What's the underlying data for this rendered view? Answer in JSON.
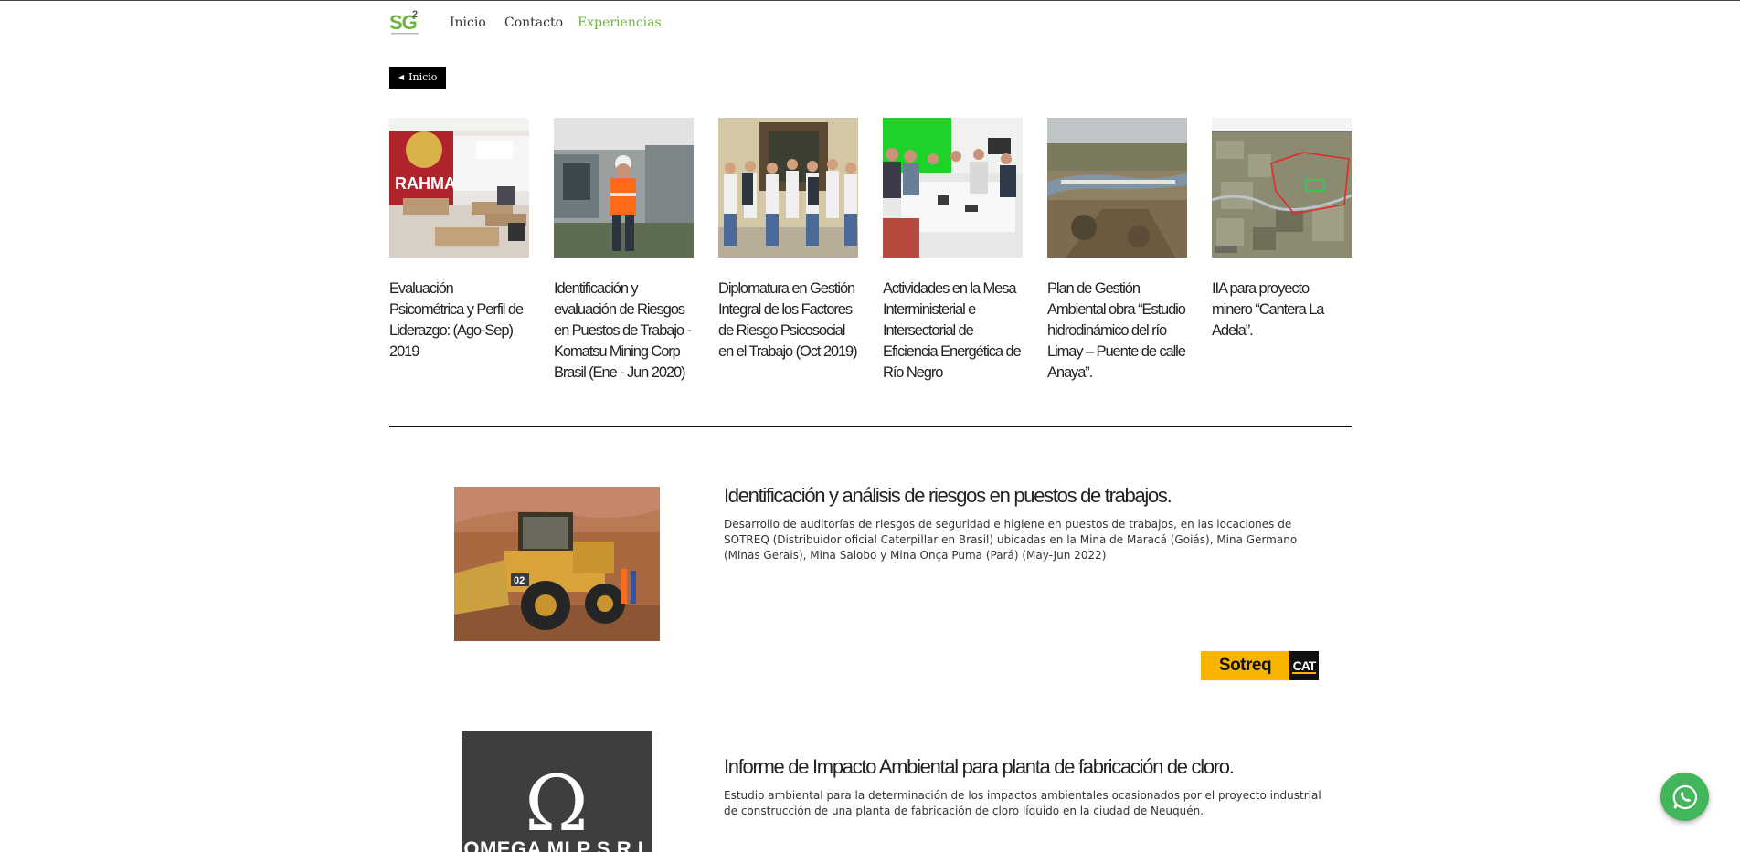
{
  "nav": {
    "logo_text": "SG2",
    "items": [
      {
        "label": "Inicio"
      },
      {
        "label": "Contacto"
      },
      {
        "label": "Experiencias"
      }
    ],
    "active_color": "#6db33f"
  },
  "back_button": {
    "label": "Inicio"
  },
  "experience_cards": [
    {
      "title": "Evaluación Psicométrica y Perfil de Liderazgo: (Ago-Sep) 2019",
      "image": "classroom-photo"
    },
    {
      "title": "Identificación y evaluación de Riesgos en Puestos de Trabajo - Komatsu Mining Corp Brasil (Ene - Jun 2020)",
      "image": "factory-worker-photo"
    },
    {
      "title": "Diplomatura en Gestión Integral de los Factores de Riesgo Psicosocial en el Trabajo (Oct 2019)",
      "image": "group-photo"
    },
    {
      "title": "Actividades en la Mesa Interministerial e Intersectorial de Eficiencia Energética de Río Negro",
      "image": "meeting-photo"
    },
    {
      "title": "Plan de Gestión Ambiental obra “Estudio hidrodinámico del río Limay – Puente de calle Anaya”.",
      "image": "aerial-river-photo"
    },
    {
      "title": "IIA para proyecto minero “Cantera La Adela”.",
      "image": "site-map-photo"
    }
  ],
  "experiences": [
    {
      "title": "Identificación y análisis de riesgos en puestos de trabajos.",
      "description": "Desarrollo de auditorías de riesgos de seguridad e higiene en puestos de trabajos, en las locaciones de SOTREQ (Distribuidor oficial Caterpillar en Brasil) ubicadas en la Mina de Maracá (Goiás), Mina Germano (Minas Gerais), Mina Salobo y Mina Onça Puma (Pará) (May-Jun 2022)",
      "image": "wheel-loader-photo",
      "partner_logo": {
        "left": "Sotreq",
        "right": "CAT"
      }
    },
    {
      "title": "Informe de Impacto Ambiental para planta de fabricación de cloro.",
      "description": "Estudio ambiental para la determinación de los impactos ambientales ocasionados por el proyecto industrial de construcción de una planta de fabricación de cloro líquido en la ciudad de Neuquén.",
      "image": "omega-logo",
      "image_text": "OMEGA MLP S.R.L"
    }
  ],
  "whatsapp": {
    "icon": "whatsapp-icon",
    "color": "#43b55a"
  }
}
